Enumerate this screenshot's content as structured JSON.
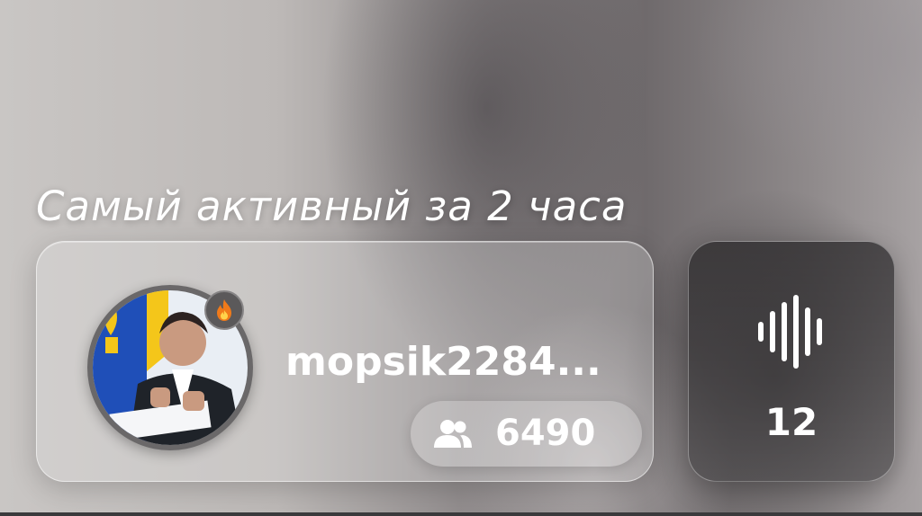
{
  "header": {
    "title": "Самый активный за 2 часа"
  },
  "user": {
    "username": "mopsik2284...",
    "followers_count": "6490",
    "avatar_icon": "user-photo",
    "badge_icon": "fire-icon"
  },
  "voice": {
    "icon": "sound-wave-icon",
    "count": "12"
  },
  "colors": {
    "text": "#ffffff",
    "card_glass": "#ebe9e8",
    "voice_card": "#2c2a2c"
  }
}
